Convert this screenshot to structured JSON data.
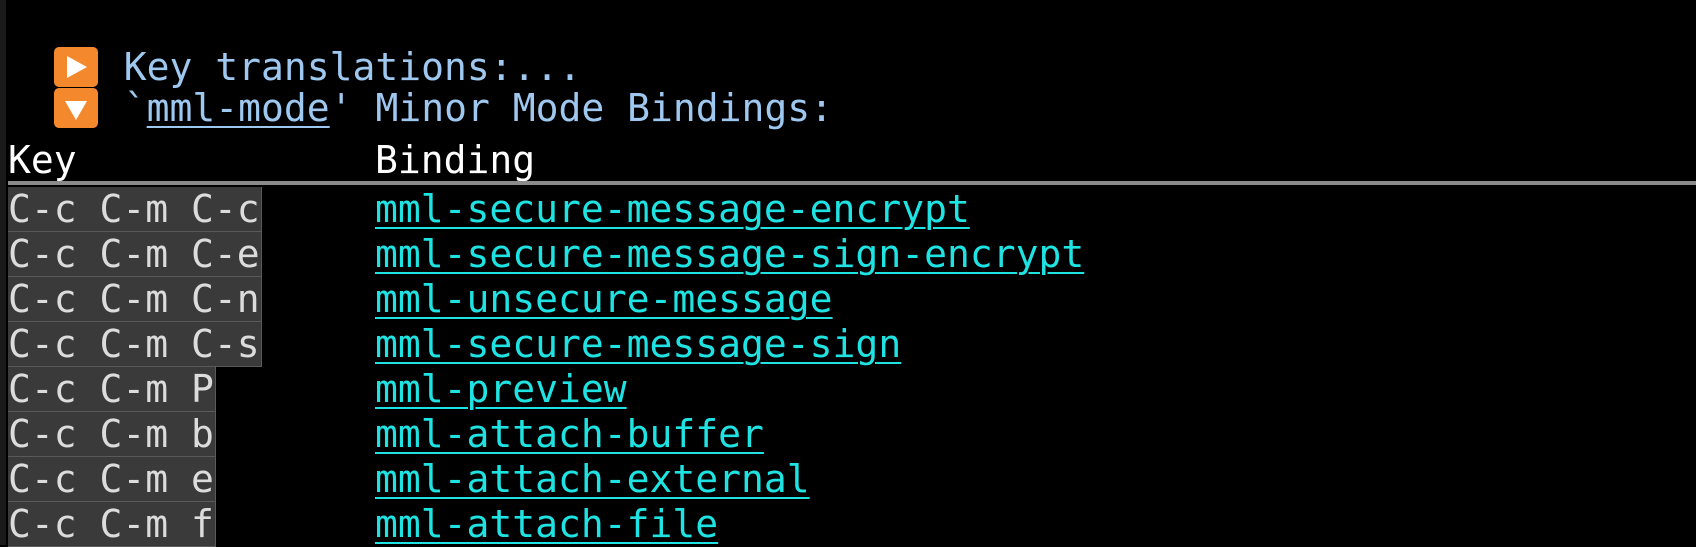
{
  "sections": [
    {
      "icon": "play-right-icon",
      "label": "Key translations:..."
    },
    {
      "icon": "play-down-icon",
      "prefix": "`",
      "mode_link": "mml-mode",
      "suffix": "' Minor Mode Bindings:"
    }
  ],
  "table": {
    "headers": {
      "key": "Key",
      "binding": "Binding"
    },
    "rows": [
      {
        "key": "C-c C-m C-c",
        "binding": "mml-secure-message-encrypt"
      },
      {
        "key": "C-c C-m C-e",
        "binding": "mml-secure-message-sign-encrypt"
      },
      {
        "key": "C-c C-m C-n",
        "binding": "mml-unsecure-message"
      },
      {
        "key": "C-c C-m C-s",
        "binding": "mml-secure-message-sign"
      },
      {
        "key": "C-c C-m P",
        "binding": "mml-preview"
      },
      {
        "key": "C-c C-m b",
        "binding": "mml-attach-buffer"
      },
      {
        "key": "C-c C-m e",
        "binding": "mml-attach-external"
      },
      {
        "key": "C-c C-m f",
        "binding": "mml-attach-file"
      }
    ]
  },
  "colors": {
    "heading": "#9ec8f0",
    "binding_link": "#1fe3e3",
    "icon_bg": "#f3892c",
    "key_bg": "#3a3a3a"
  }
}
